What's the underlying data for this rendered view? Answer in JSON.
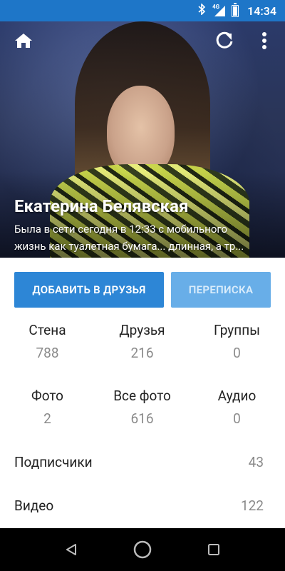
{
  "status_bar": {
    "time": "14:34",
    "network": "4G",
    "icons": [
      "bluetooth-icon",
      "signal-icon",
      "battery-icon"
    ]
  },
  "profile": {
    "name": "Екатерина Белявская",
    "last_seen": "Была в сети сегодня в 12:33 с мобильного",
    "status_text": "жизнь как туалетная бумага... длинная, а тр..."
  },
  "buttons": {
    "add_friend": "ДОБАВИТЬ В ДРУЗЬЯ",
    "messages": "ПЕРЕПИСКА"
  },
  "stats": [
    {
      "label": "Стена",
      "value": "788"
    },
    {
      "label": "Друзья",
      "value": "216"
    },
    {
      "label": "Группы",
      "value": "0"
    },
    {
      "label": "Фото",
      "value": "2"
    },
    {
      "label": "Все фото",
      "value": "616"
    },
    {
      "label": "Аудио",
      "value": "0"
    }
  ],
  "rows": [
    {
      "label": "Подписчики",
      "value": "43"
    },
    {
      "label": "Видео",
      "value": "122"
    }
  ],
  "colors": {
    "status_bar": "#1e76c8",
    "primary_button": "#2d86d6",
    "disabled_button": "#68aee8"
  }
}
